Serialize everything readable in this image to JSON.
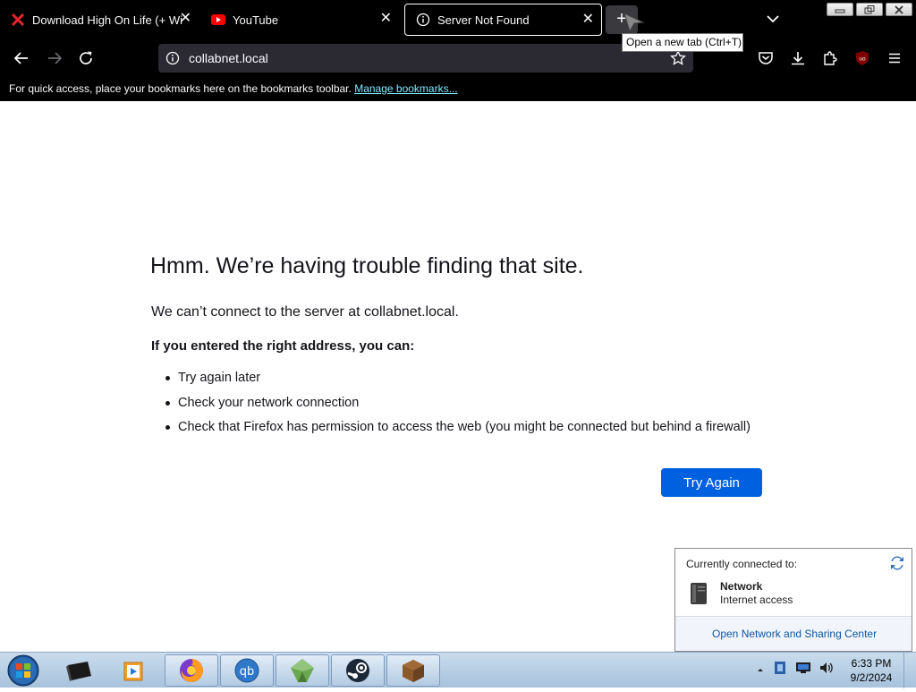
{
  "tabs": [
    {
      "title": "Download High On Life (+ Windows",
      "favicon": "x-logo-icon"
    },
    {
      "title": "YouTube",
      "favicon": "youtube-icon"
    },
    {
      "title": "Server Not Found",
      "favicon": "info-icon",
      "active": true
    }
  ],
  "new_tab_tooltip": "Open a new tab (Ctrl+T)",
  "address_bar": {
    "url": "collabnet.local"
  },
  "bookmarks_bar": {
    "text": "For quick access, place your bookmarks here on the bookmarks toolbar.",
    "link": "Manage bookmarks..."
  },
  "error_page": {
    "title": "Hmm. We’re having trouble finding that site.",
    "short_desc": "We can’t connect to the server at collabnet.local.",
    "subheading": "If you entered the right address, you can:",
    "suggestions": [
      "Try again later",
      "Check your network connection",
      "Check that Firefox has permission to access the web (you might be connected but behind a firewall)"
    ],
    "button": "Try Again"
  },
  "network_popup": {
    "header": "Currently connected to:",
    "network_name": "Network",
    "network_status": "Internet access",
    "footer_link": "Open Network and Sharing Center"
  },
  "taskbar": {
    "items": [
      "monitor-app-icon",
      "media-player-icon",
      "firefox-icon",
      "qbittorrent-icon",
      "minecraft-launcher-icon",
      "steam-icon",
      "minecraft-block-icon"
    ],
    "clock_time": "6:33 PM",
    "clock_date": "9/2/2024"
  },
  "colors": {
    "accent_button": "#0061e0",
    "link": "#80ebff",
    "tab_bar": "#000000"
  }
}
